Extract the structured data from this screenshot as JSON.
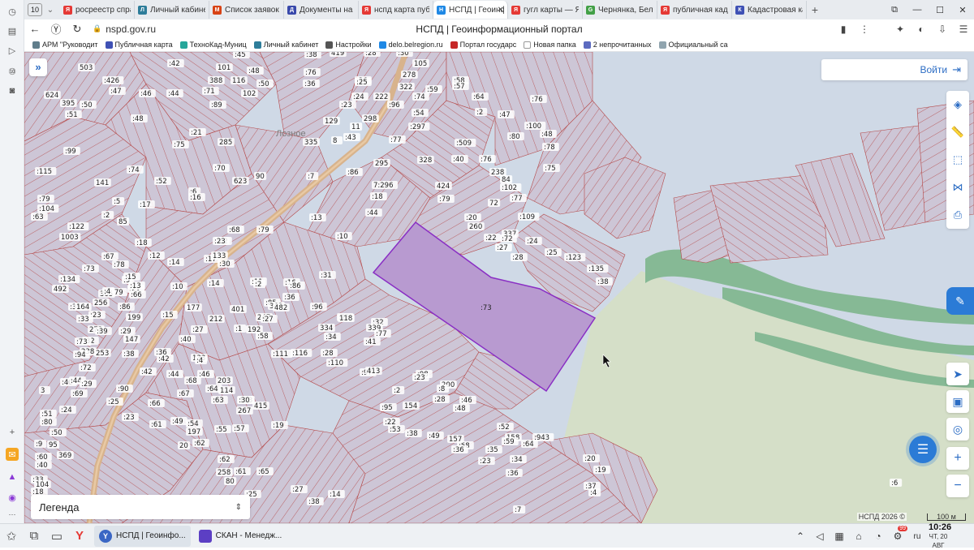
{
  "browser": {
    "tab_count": "10",
    "tabs": [
      {
        "label": "росреестр справ",
        "color": "#e53935",
        "glyph": "Я"
      },
      {
        "label": "Личный кабинет",
        "color": "#2e7d9a",
        "glyph": "Л"
      },
      {
        "label": "Список заявок —",
        "color": "#d84315",
        "glyph": "M"
      },
      {
        "label": "Документы на ис",
        "color": "#3949ab",
        "glyph": "Д"
      },
      {
        "label": "нспд карта публ",
        "color": "#e53935",
        "glyph": "Я"
      },
      {
        "label": "НСПД | Геоинф",
        "color": "#1e88e5",
        "glyph": "Н",
        "active": true
      },
      {
        "label": "гугл карты — Янд",
        "color": "#e53935",
        "glyph": "Я"
      },
      {
        "label": "Чернянка, Белго",
        "color": "#43a047",
        "glyph": "G"
      },
      {
        "label": "публичная када",
        "color": "#e53935",
        "glyph": "Я"
      },
      {
        "label": "Кадастровая кар",
        "color": "#3f51b5",
        "glyph": "К"
      }
    ],
    "url": "nspd.gov.ru",
    "page_title": "НСПД | Геоинформационный портал",
    "bookmarks": [
      {
        "label": "АРМ \"Руководит",
        "color": "#607d8b"
      },
      {
        "label": "Публичная карта",
        "color": "#3f51b5"
      },
      {
        "label": "ТехноКад-Муниц",
        "color": "#26a69a"
      },
      {
        "label": "Личный кабинет",
        "color": "#2e7d9a"
      },
      {
        "label": "Настройки",
        "color": "#555555"
      },
      {
        "label": "delo.belregion.ru",
        "color": "#1e88e5"
      },
      {
        "label": "Портал государс",
        "color": "#c62828"
      },
      {
        "label": "Новая папка",
        "color": "#ffffff"
      },
      {
        "label": "2 непрочитанных",
        "color": "#5c6bc0"
      },
      {
        "label": "Официальный са",
        "color": "#90a4ae"
      }
    ]
  },
  "map": {
    "login_label": "Войти",
    "legend_label": "Легенда",
    "copyright": "НСПД 2026 ©",
    "scale": "100 м",
    "place_name": "Лозное",
    "parcel_selected": ":73",
    "parcel_labels": [
      {
        "t": "503"
      },
      {
        "t": ":42"
      },
      {
        "t": "101"
      },
      {
        "t": ":45"
      },
      {
        "t": ":38"
      },
      {
        "t": "419"
      },
      {
        "t": ":28"
      },
      {
        "t": ":30"
      },
      {
        "t": "105"
      },
      {
        "t": ":426"
      },
      {
        "t": "388"
      },
      {
        "t": "116"
      },
      {
        "t": ":48"
      },
      {
        "t": ":36"
      },
      {
        "t": ":26"
      },
      {
        "t": "278"
      },
      {
        "t": "624"
      },
      {
        "t": ":47"
      },
      {
        "t": ":46"
      },
      {
        "t": ":44"
      },
      {
        "t": ":71"
      },
      {
        "t": "102"
      },
      {
        "t": ":50"
      },
      {
        "t": ":76"
      },
      {
        "t": ":25"
      },
      {
        "t": "322"
      },
      {
        "t": ":59"
      },
      {
        "t": ":58"
      },
      {
        "t": "395"
      },
      {
        "t": ":50"
      },
      {
        "t": ":89"
      },
      {
        "t": ":24"
      },
      {
        "t": "222"
      },
      {
        "t": ":74"
      },
      {
        "t": ":57"
      },
      {
        "t": ":64"
      },
      {
        "t": ":76"
      },
      {
        "t": ":51"
      },
      {
        "t": ":48"
      },
      {
        "t": ":23"
      },
      {
        "t": "298"
      },
      {
        "t": ":96"
      },
      {
        "t": ":54"
      },
      {
        "t": ":2"
      },
      {
        "t": ":47"
      },
      {
        "t": ":100"
      },
      {
        "t": ":21"
      },
      {
        "t": "129"
      },
      {
        "t": "11"
      },
      {
        "t": ":297"
      },
      {
        "t": ":48"
      },
      {
        "t": ":80"
      },
      {
        "t": ":99"
      },
      {
        "t": ":75"
      },
      {
        "t": "285"
      },
      {
        "t": "335"
      },
      {
        "t": "8"
      },
      {
        "t": ":43"
      },
      {
        "t": ":77"
      },
      {
        "t": ":509"
      },
      {
        "t": ":78"
      },
      {
        "t": ":115"
      },
      {
        "t": ":74"
      },
      {
        "t": ":70"
      },
      {
        "t": "90"
      },
      {
        "t": ":7"
      },
      {
        "t": ":86"
      },
      {
        "t": "295"
      },
      {
        "t": "328"
      },
      {
        "t": ":40"
      },
      {
        "t": ":76"
      },
      {
        "t": ":75"
      },
      {
        "t": "141"
      },
      {
        "t": ":52"
      },
      {
        "t": "623"
      },
      {
        "t": ":6"
      },
      {
        "t": ":16"
      },
      {
        "t": "7:296"
      },
      {
        "t": "424"
      },
      {
        "t": "238"
      },
      {
        "t": "84"
      },
      {
        "t": ":102"
      },
      {
        "t": ":77"
      },
      {
        "t": ":79"
      },
      {
        "t": ":5"
      },
      {
        "t": ":17"
      },
      {
        "t": ":18"
      },
      {
        "t": ":79"
      },
      {
        "t": "72"
      },
      {
        "t": ":109"
      },
      {
        "t": ":104"
      },
      {
        "t": ":63"
      },
      {
        "t": ":2"
      },
      {
        "t": "85"
      },
      {
        "t": ":13"
      },
      {
        "t": ":44"
      },
      {
        "t": ":20"
      },
      {
        "t": "260"
      },
      {
        "t": ":122"
      },
      {
        "t": "1003"
      },
      {
        "t": ":79"
      },
      {
        "t": ":68"
      },
      {
        "t": ":62"
      },
      {
        "t": ":10"
      },
      {
        "t": "337"
      },
      {
        "t": ":24"
      },
      {
        "t": ":22"
      },
      {
        "t": ":72"
      },
      {
        "t": ":18"
      },
      {
        "t": ":23"
      },
      {
        "t": ":27"
      },
      {
        "t": ":25"
      },
      {
        "t": ":28"
      },
      {
        "t": ":123"
      },
      {
        "t": ":73"
      },
      {
        "t": ":67"
      },
      {
        "t": ":78"
      },
      {
        "t": ":12"
      },
      {
        "t": ":14"
      },
      {
        "t": ":17"
      },
      {
        "t": "133"
      },
      {
        "t": ":30"
      },
      {
        "t": ":135"
      },
      {
        "t": ":134"
      },
      {
        "t": "492"
      },
      {
        "t": ":9"
      },
      {
        "t": ":15"
      },
      {
        "t": ":10"
      },
      {
        "t": ":11"
      },
      {
        "t": ":2"
      },
      {
        "t": ":16"
      },
      {
        "t": ":31"
      },
      {
        "t": ":38"
      },
      {
        "t": ":79"
      },
      {
        "t": "365"
      },
      {
        "t": ":21"
      },
      {
        "t": ":13"
      },
      {
        "t": ":14"
      },
      {
        "t": ":86"
      },
      {
        "t": ":36"
      },
      {
        "t": "256"
      },
      {
        "t": ":4"
      },
      {
        "t": ":66"
      },
      {
        "t": ":85"
      },
      {
        "t": "343"
      },
      {
        "t": "482"
      },
      {
        "t": ":35"
      },
      {
        "t": "164"
      },
      {
        "t": ":86"
      },
      {
        "t": "177"
      },
      {
        "t": "401"
      },
      {
        "t": "247"
      },
      {
        "t": ":96"
      },
      {
        "t": ":25"
      },
      {
        "t": ":23"
      },
      {
        "t": ":33"
      },
      {
        "t": "199"
      },
      {
        "t": ":15"
      },
      {
        "t": "212"
      },
      {
        "t": ":27"
      },
      {
        "t": "118"
      },
      {
        "t": ":32"
      },
      {
        "t": "272"
      },
      {
        "t": ":39"
      },
      {
        "t": ":29"
      },
      {
        "t": ":27"
      },
      {
        "t": ":1"
      },
      {
        "t": "192"
      },
      {
        "t": "334"
      },
      {
        "t": "339"
      },
      {
        "t": ":77"
      },
      {
        "t": ":32"
      },
      {
        "t": "147"
      },
      {
        "t": ":40"
      },
      {
        "t": ":58"
      },
      {
        "t": ":34"
      },
      {
        "t": ":73"
      },
      {
        "t": "238"
      },
      {
        "t": "253"
      },
      {
        "t": ":36"
      },
      {
        "t": ":111"
      },
      {
        "t": ":116"
      },
      {
        "t": ":28"
      },
      {
        "t": ":41"
      },
      {
        "t": ":94"
      },
      {
        "t": ":38"
      },
      {
        "t": ":42"
      },
      {
        "t": "133"
      },
      {
        "t": ":4"
      },
      {
        "t": ":110"
      },
      {
        "t": ":72"
      },
      {
        "t": ":42"
      },
      {
        "t": ":44"
      },
      {
        "t": ":46"
      },
      {
        "t": ":97"
      },
      {
        "t": ":98"
      },
      {
        "t": ":40"
      },
      {
        "t": ":44"
      },
      {
        "t": ":29"
      },
      {
        "t": ":90"
      },
      {
        "t": ":68"
      },
      {
        "t": "203"
      },
      {
        "t": "413"
      },
      {
        "t": ":23"
      },
      {
        "t": "200"
      },
      {
        "t": ":8"
      },
      {
        "t": "3"
      },
      {
        "t": ":69"
      },
      {
        "t": ":67"
      },
      {
        "t": ":64"
      },
      {
        "t": "114"
      },
      {
        "t": "103"
      },
      {
        "t": ":2"
      },
      {
        "t": "154"
      },
      {
        "t": ":28"
      },
      {
        "t": ":46"
      },
      {
        "t": ":48"
      },
      {
        "t": ":24"
      },
      {
        "t": ":25"
      },
      {
        "t": ":66"
      },
      {
        "t": ":63"
      },
      {
        "t": "267"
      },
      {
        "t": ":30"
      },
      {
        "t": "415"
      },
      {
        "t": ":51"
      },
      {
        "t": ":80"
      },
      {
        "t": ":23"
      },
      {
        "t": ":61"
      },
      {
        "t": ":49"
      },
      {
        "t": ":54"
      },
      {
        "t": ":55"
      },
      {
        "t": ":57"
      },
      {
        "t": ":22"
      },
      {
        "t": ":95"
      },
      {
        "t": ":58"
      },
      {
        "t": ":52"
      },
      {
        "t": ":50"
      },
      {
        "t": "95"
      },
      {
        "t": "197"
      },
      {
        "t": ":62"
      },
      {
        "t": ":19"
      },
      {
        "t": ":53"
      },
      {
        "t": ":38"
      },
      {
        "t": "158"
      },
      {
        "t": ":59"
      },
      {
        "t": ":9"
      },
      {
        "t": ":60"
      },
      {
        "t": "20"
      },
      {
        "t": ":62"
      },
      {
        "t": ":49"
      },
      {
        "t": "157"
      },
      {
        "t": ":64"
      },
      {
        "t": ":943"
      },
      {
        "t": ":40"
      },
      {
        "t": "369"
      },
      {
        "t": "258"
      },
      {
        "t": ":61"
      },
      {
        "t": ":65"
      },
      {
        "t": ":36"
      },
      {
        "t": ":35"
      },
      {
        "t": ":34"
      },
      {
        "t": ":33"
      },
      {
        "t": "104"
      },
      {
        "t": "80"
      },
      {
        "t": ":25"
      },
      {
        "t": ":27"
      },
      {
        "t": ":23"
      },
      {
        "t": ":20"
      },
      {
        "t": ":19"
      },
      {
        "t": ":18"
      },
      {
        "t": ":38"
      },
      {
        "t": ":14"
      },
      {
        "t": ":36"
      },
      {
        "t": ":37"
      },
      {
        "t": ":4"
      },
      {
        "t": ":6"
      },
      {
        "t": ":7"
      }
    ]
  },
  "taskbar": {
    "apps": [
      {
        "label": "НСПД | Геоинфо...",
        "color": "#3a66c4",
        "glyph": "Y",
        "active": true
      },
      {
        "label": "СКАН - Менедж...",
        "color": "#5c3fc4",
        "glyph": ""
      }
    ],
    "lang": "ru",
    "time": "10:26",
    "date": "ЧТ, 20 АВГ",
    "notif_count": "99"
  },
  "colors": {
    "accent": "#2b6cc4",
    "parcel_fill": "#cfc8d8",
    "parcel_stroke": "#b54848",
    "selected_fill": "#b89ad0",
    "selected_stroke": "#8a2fc4",
    "road": "#d7b08a",
    "river": "#85b993",
    "field": "#d5dfc8",
    "water_bg": "#cfd9e6"
  }
}
